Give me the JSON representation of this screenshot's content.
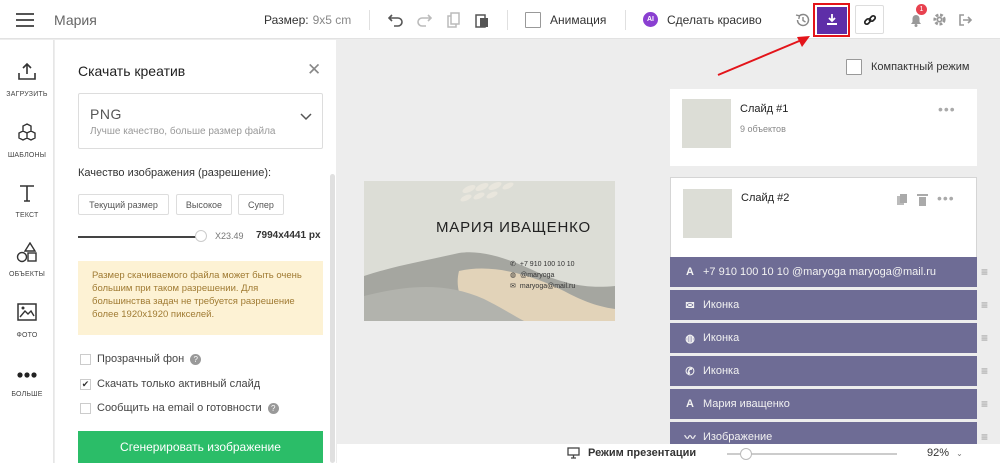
{
  "topbar": {
    "project_title": "Мария",
    "size_label": "Размер:",
    "size_value": "9x5 cm",
    "animation_label": "Анимация",
    "ai_badge": "AI",
    "make_pretty_label": "Сделать красиво",
    "notification_count": "1",
    "icons": [
      "menu-icon",
      "undo-icon",
      "redo-icon",
      "copy-icon",
      "paste-icon",
      "history-icon",
      "download-icon",
      "link-icon",
      "bell-icon",
      "gear-icon",
      "exit-icon"
    ]
  },
  "left_sidebar": {
    "items": [
      {
        "label": "ЗАГРУЗИТЬ",
        "icon": "upload-icon"
      },
      {
        "label": "ШАБЛОНЫ",
        "icon": "templates-icon"
      },
      {
        "label": "ТЕКСТ",
        "icon": "text-icon"
      },
      {
        "label": "ОБЪЕКТЫ",
        "icon": "shapes-icon"
      },
      {
        "label": "ФОТО",
        "icon": "photo-icon"
      },
      {
        "label": "БОЛЬШЕ",
        "icon": "more-icon"
      }
    ]
  },
  "download_panel": {
    "title": "Скачать креатив",
    "format": {
      "name": "PNG",
      "description": "Лучше качество, больше размер файла"
    },
    "quality_label": "Качество изображения (разрешение):",
    "quality_buttons": [
      "Текущий размер",
      "Высокое",
      "Супер"
    ],
    "scale_value": "X23.49",
    "pixel_size": "7994x4441 px",
    "scale_fraction": 0.95,
    "warning_text": "Размер скачиваемого файла может быть очень большим при таком разрешении. Для большинства задач не требуется разрешение более 1920x1920 пикселей.",
    "options": [
      {
        "label": "Прозрачный фон",
        "checked": false,
        "help": true
      },
      {
        "label": "Скачать только активный слайд",
        "checked": true,
        "help": false
      },
      {
        "label": "Сообщить на email о готовности",
        "checked": false,
        "help": true
      }
    ],
    "generate_button": "Сгенерировать изображение"
  },
  "canvas": {
    "compact_mode_label": "Компактный режим",
    "card": {
      "name": "МАРИЯ ИВАЩЕНКО",
      "phone": "+7 910 100 10 10",
      "instagram": "@maryoga",
      "email": "maryoga@mail.ru"
    }
  },
  "slides": [
    {
      "title": "Слайд #1",
      "subtitle": "9 объектов"
    },
    {
      "title": "Слайд #2",
      "subtitle": ""
    }
  ],
  "layers": [
    {
      "icon": "text-icon",
      "label": "+7 910 100 10 10 @maryoga maryoga@mail.ru"
    },
    {
      "icon": "envelope-icon",
      "label": "Иконка"
    },
    {
      "icon": "globe-icon",
      "label": "Иконка"
    },
    {
      "icon": "phone-icon",
      "label": "Иконка"
    },
    {
      "icon": "text-icon",
      "label": "Мария иващенко"
    },
    {
      "icon": "image-icon",
      "label": "Изображение"
    }
  ],
  "bottombar": {
    "presentation_label": "Режим презентации",
    "zoom_value": "92%",
    "zoom_fraction": 0.08
  },
  "colors": {
    "accent": "#5e2ea8",
    "highlight": "#e3141a",
    "generate": "#2bbd68",
    "layer_bg": "#6e6c95",
    "warning_bg": "#fdf2d4"
  }
}
